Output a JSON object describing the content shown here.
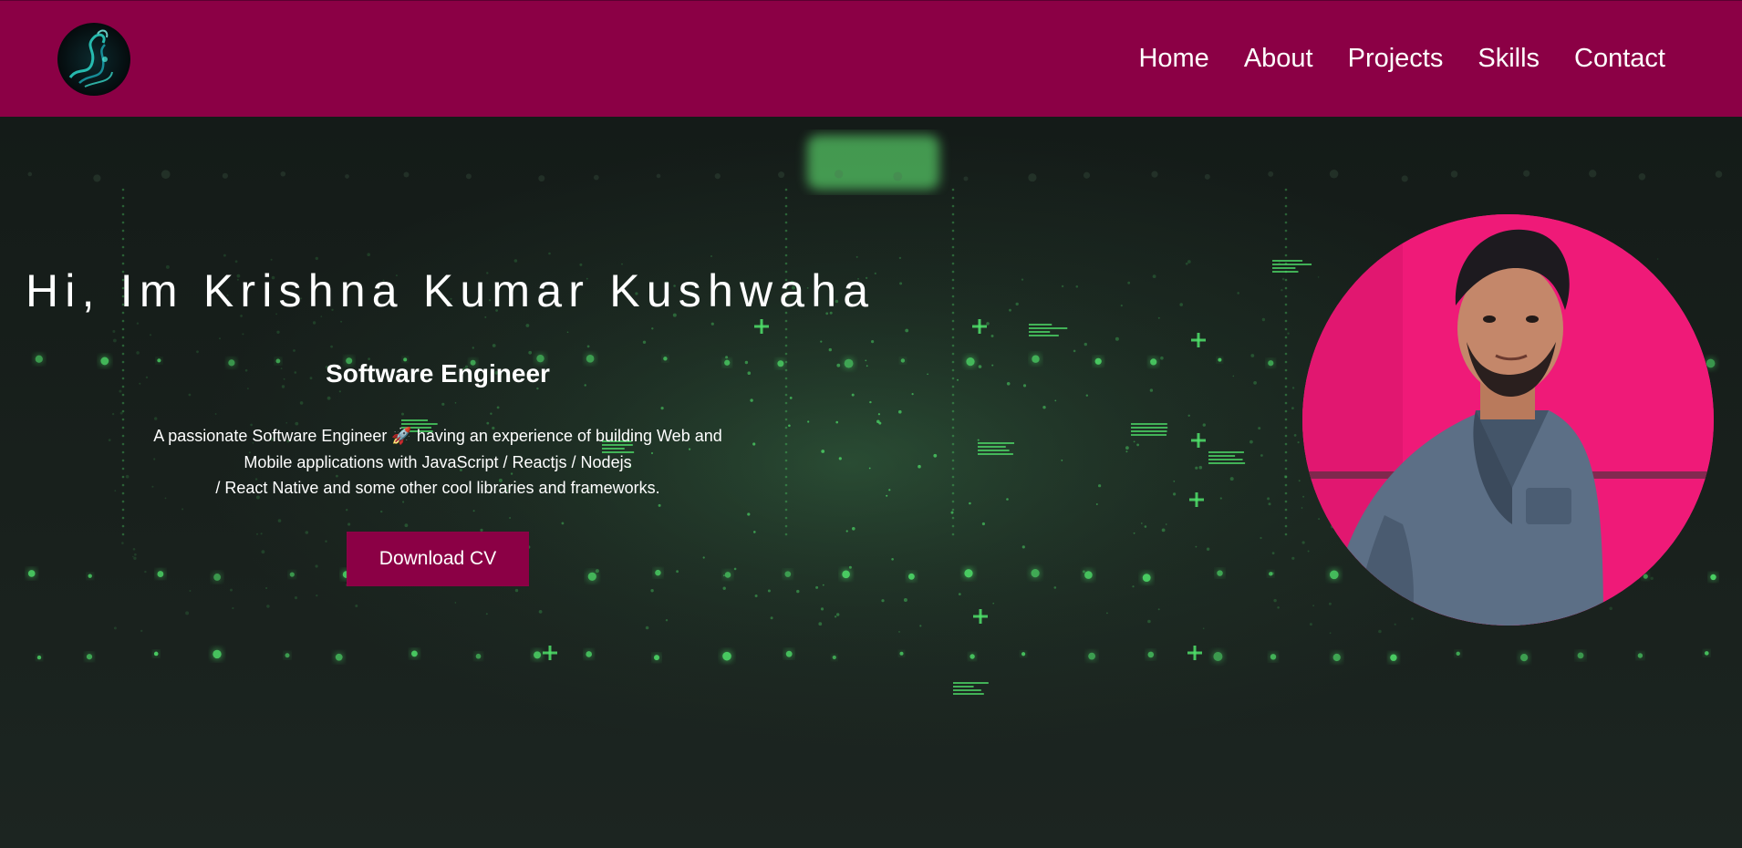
{
  "header": {
    "logo_icon": "smoke-swirl-logo-icon",
    "nav": [
      {
        "label": "Home"
      },
      {
        "label": "About"
      },
      {
        "label": "Projects"
      },
      {
        "label": "Skills"
      },
      {
        "label": "Contact"
      }
    ]
  },
  "hero": {
    "title": "Hi, Im Krishna Kumar Kushwaha",
    "subtitle": "Software Engineer",
    "description": {
      "line1": "A passionate Software Engineer 🚀 having an experience of building Web and",
      "line2": "Mobile applications with JavaScript / Reactjs / Nodejs",
      "line3": "/ React Native and some other cool libraries and frameworks."
    },
    "download_label": "Download CV",
    "background_icon": "digital-matrix-background",
    "profile_icon": "profile-photo"
  },
  "colors": {
    "brand": "#8b0045",
    "hero_background": "#18201c",
    "matrix_green": "#4fe06a",
    "profile_background": "#ef1a78",
    "text": "#ffffff"
  }
}
